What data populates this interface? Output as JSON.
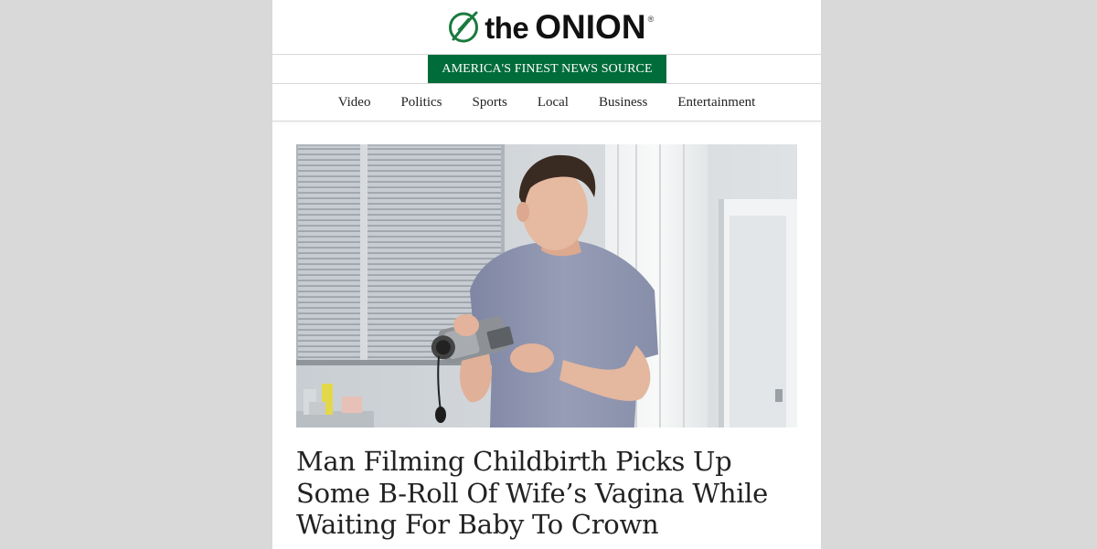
{
  "header": {
    "logo_the": "the",
    "logo_onion": "ONION",
    "logo_reg": "®",
    "tagline": "AMERICA'S FINEST NEWS SOURCE"
  },
  "nav": {
    "items": [
      "Video",
      "Politics",
      "Sports",
      "Local",
      "Business",
      "Entertainment"
    ]
  },
  "article": {
    "headline": "Man Filming Childbirth Picks Up Some B-Roll Of Wife’s Vagina While Waiting For Baby To Crown"
  },
  "colors": {
    "brand_green": "#006c3a",
    "backdrop": "#d9d9d9"
  },
  "icons": {
    "logo": "onion-leaf-icon"
  }
}
